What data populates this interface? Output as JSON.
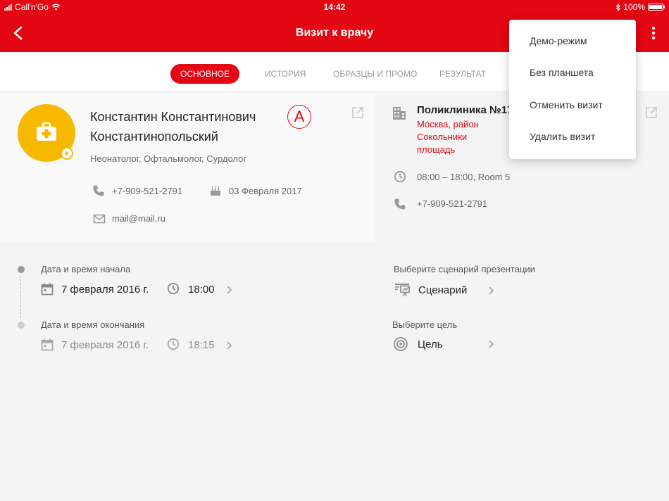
{
  "status_bar": {
    "carrier": "Call'n'Go",
    "time": "14:42",
    "battery": "100%"
  },
  "header": {
    "title": "Визит к врачу",
    "back_icon": "chevron-left-icon",
    "more_icon": "more-vertical-icon"
  },
  "tabs": [
    {
      "label": "Основное",
      "active": true
    },
    {
      "label": "История",
      "active": false
    },
    {
      "label": "Образцы и промо",
      "active": false
    },
    {
      "label": "Результат",
      "active": false
    }
  ],
  "doctor": {
    "name_line1": "Константин Константинович",
    "name_line2": "Константинопольский",
    "badge": "A",
    "specialties": "Неонатолог, Офтальмолог, Сурдолог",
    "phone": "+7-909-521-2791",
    "birthday": "03 Февраля 2017",
    "email": "mail@mail.ru"
  },
  "clinic": {
    "name": "Поликлиника №17",
    "address_line1": "Москва, район Сокольники",
    "address_line2": "площадь",
    "hours": "08:00 – 18:00, Room 5",
    "phone": "+7-909-521-2791"
  },
  "visit": {
    "start_label": "Дата и время начала",
    "start_date": "7 февраля 2016 г.",
    "start_time": "18:00",
    "end_label": "Дата и время окончания",
    "end_date": "7 февраля 2016 г.",
    "end_time": "18:15"
  },
  "presentation": {
    "scenario_label": "Выберите сценарий презентации",
    "scenario_value": "Сценарий",
    "goal_label": "Выберите цель",
    "goal_value": "Цель"
  },
  "menu": {
    "items": [
      "Демо-режим",
      "Без планшета",
      "Отменить визит",
      "Удалить визит"
    ]
  },
  "colors": {
    "brand_red": "#e30613",
    "avatar_yellow": "#f7b900",
    "background": "#f4f4f4"
  }
}
